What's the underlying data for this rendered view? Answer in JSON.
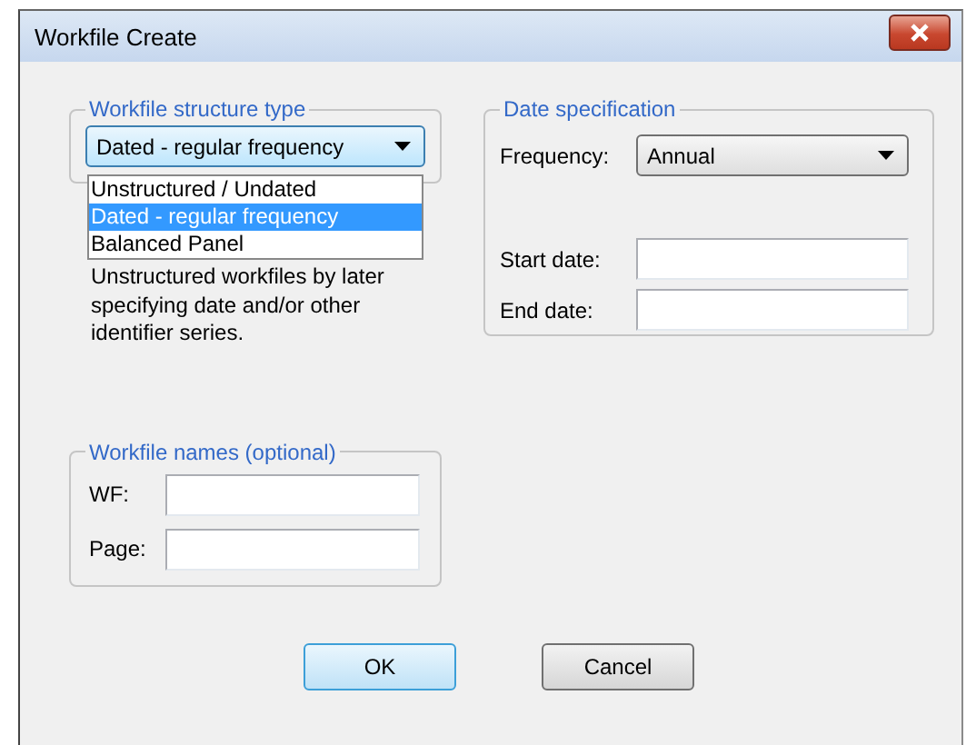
{
  "window": {
    "title": "Workfile Create"
  },
  "structure_group": {
    "legend": "Workfile structure type",
    "value": "Dated - regular frequency",
    "expanded": true,
    "options": [
      {
        "label": "Unstructured / Undated",
        "selected": false
      },
      {
        "label": "Dated - regular frequency",
        "selected": true
      },
      {
        "label": "Balanced Panel",
        "selected": false
      }
    ],
    "description": "Unstructured workfiles by later specifying date and/or other identifier series."
  },
  "date_group": {
    "legend": "Date specification",
    "fields": [
      {
        "kind": "dropdown",
        "label": "Frequency:",
        "value": "Annual"
      },
      {
        "kind": "text",
        "label": "Start date:"
      },
      {
        "kind": "text",
        "label": "End date:"
      }
    ]
  },
  "names_group": {
    "legend": "Workfile names (optional)",
    "fields": [
      {
        "label": "WF:"
      },
      {
        "label": "Page:"
      }
    ]
  },
  "buttons": [
    {
      "label": "OK",
      "default": true
    },
    {
      "label": "Cancel",
      "default": false
    }
  ]
}
